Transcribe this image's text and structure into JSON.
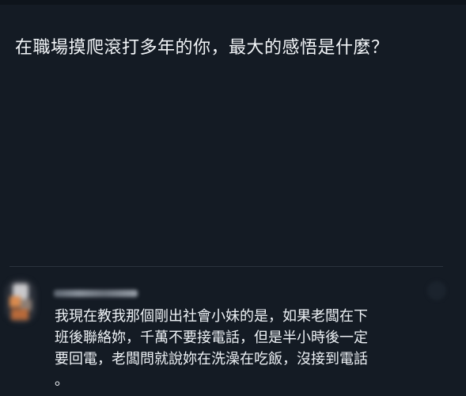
{
  "post": {
    "question": "在職場摸爬滾打多年的你，最大的感悟是什麼？"
  },
  "comment": {
    "lines": [
      "我現在教我那個剛出社會小妹的是，如果老闆在下",
      "班後聯絡妳，千萬不要接電話，但是半小時後一定",
      "要回電，老闆問就說妳在洗澡在吃飯，沒接到電話",
      "。"
    ]
  },
  "colors": {
    "background": "#141b24",
    "text": "#eef2f6",
    "divider": "#2a333e"
  }
}
